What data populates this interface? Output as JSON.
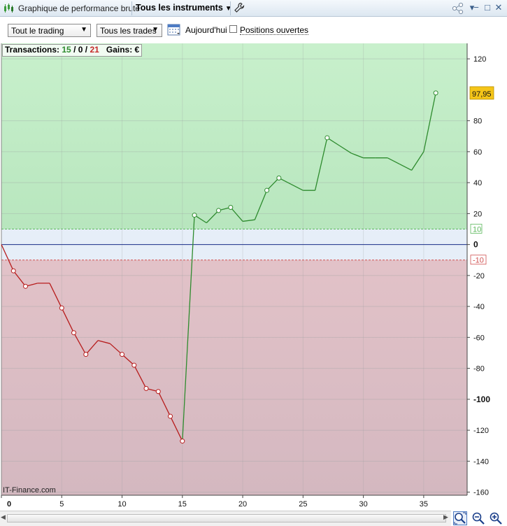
{
  "titlebar": {
    "title": "Graphique de performance brute",
    "instruments": "Tous les instruments",
    "minimize": "−",
    "restore": "□",
    "close": "✕"
  },
  "toolbar": {
    "period_select": "Tout le trading",
    "trades_select": "Tous les trades",
    "today_label": "Aujourd'hui",
    "open_positions_label": "Positions ouvertes",
    "open_positions_checked": false
  },
  "stats": {
    "label": "Transactions:",
    "wins": "15",
    "neutral": "0",
    "losses": "21",
    "sep": "/",
    "gains_label": "Gains:",
    "gains_value": "€"
  },
  "watermark": "IT-Finance.com",
  "chart_data": {
    "type": "line",
    "x": [
      0,
      1,
      2,
      3,
      4,
      5,
      6,
      7,
      8,
      9,
      10,
      11,
      12,
      13,
      14,
      15,
      16,
      17,
      18,
      19,
      20,
      21,
      22,
      23,
      24,
      25,
      26,
      27,
      28,
      29,
      30,
      31,
      32,
      33,
      34,
      35,
      36
    ],
    "y": [
      0,
      -17,
      -27,
      -25,
      -25,
      -41,
      -57,
      -71,
      -62,
      -64,
      -71,
      -78,
      -93,
      -95,
      -111,
      -127,
      19,
      14,
      22,
      24,
      15,
      16,
      35,
      43,
      39,
      35,
      35,
      69,
      64,
      59,
      56,
      56,
      56,
      52,
      48,
      60,
      97.95
    ],
    "markers": [
      1,
      2,
      5,
      6,
      7,
      10,
      11,
      12,
      13,
      14,
      15,
      16,
      18,
      19,
      22,
      23,
      27,
      36
    ],
    "xlim": [
      0,
      38.6
    ],
    "ylim": [
      -162,
      130
    ],
    "xticks": [
      0,
      5,
      10,
      15,
      20,
      25,
      30,
      35
    ],
    "yticks": [
      120,
      80,
      60,
      40,
      20,
      0,
      -20,
      -40,
      -60,
      -80,
      -100,
      -120,
      -140,
      -160
    ],
    "bold_yticks": [
      0,
      -100
    ],
    "threshold_upper": 10,
    "threshold_lower": -10,
    "last_value_label": "97,95",
    "colors": {
      "gain_zone": "#c8f0cc",
      "loss_zone": "#e2c2c8",
      "neutral_zone": "#e6eef8",
      "line_positive": "#2e8b2e",
      "line_negative": "#b71c1c",
      "threshold_upper": "#5cb85c",
      "threshold_lower": "#d05050",
      "zero_line": "#1a2f8a",
      "last_value_bg": "#f5c518"
    }
  }
}
